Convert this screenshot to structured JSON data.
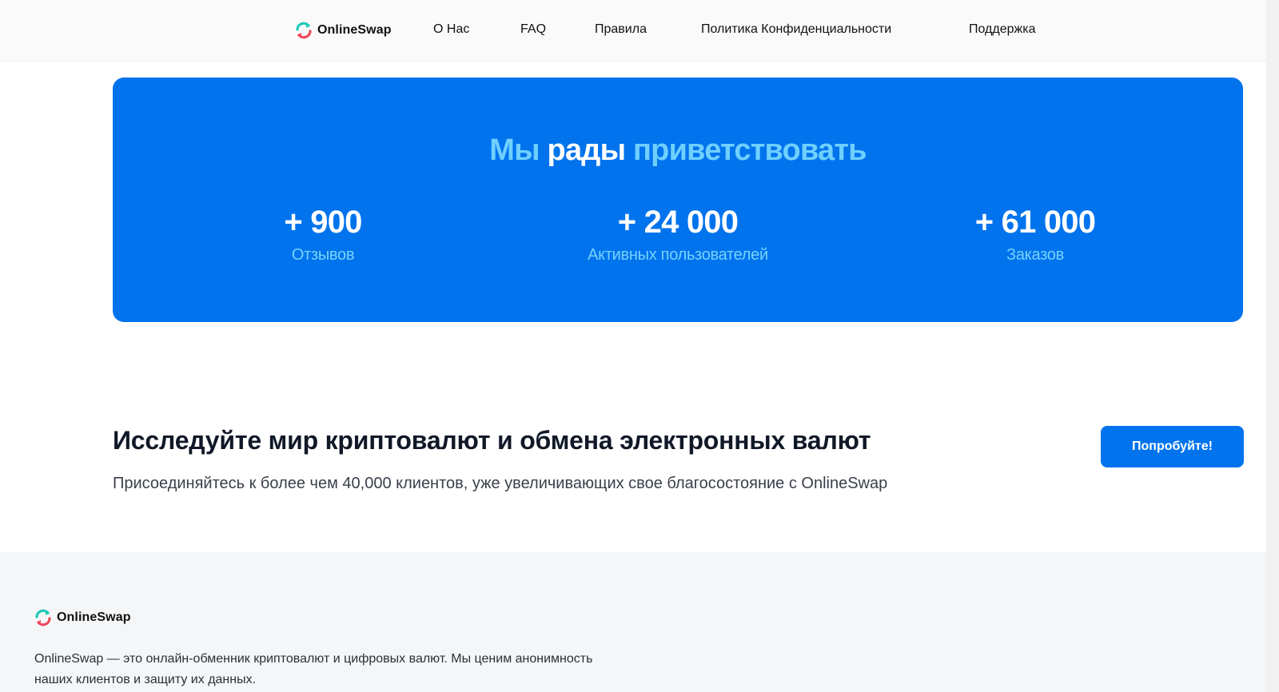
{
  "header": {
    "brand": "OnlineSwap",
    "nav": [
      "О Нас",
      "FAQ",
      "Правила",
      "Политика Конфиденциальности",
      "Поддержка"
    ]
  },
  "hero": {
    "title_part1": "Мы",
    "title_part2": "рады",
    "title_part3": "приветствовать",
    "stats": [
      {
        "value": "+ 900",
        "label": "Отзывов"
      },
      {
        "value": "+ 24 000",
        "label": "Активных пользователей"
      },
      {
        "value": "+ 61 000",
        "label": "Заказов"
      }
    ]
  },
  "cta": {
    "title": "Исследуйте мир криптовалют и обмена электронных валют",
    "subtitle": "Присоединяйтесь к более чем 40,000 клиентов, уже увеличивающих свое благосостояние с OnlineSwap",
    "button": "Попробуйте!"
  },
  "footer": {
    "brand": "OnlineSwap",
    "description": "OnlineSwap — это онлайн-обменник криптовалют и цифровых валют. Мы ценим анонимность наших клиентов и защиту их данных."
  },
  "colors": {
    "primary": "#0073ed",
    "accent_light": "#6fd0ff",
    "logo_teal": "#1ec9b7",
    "logo_red": "#f0475a"
  }
}
